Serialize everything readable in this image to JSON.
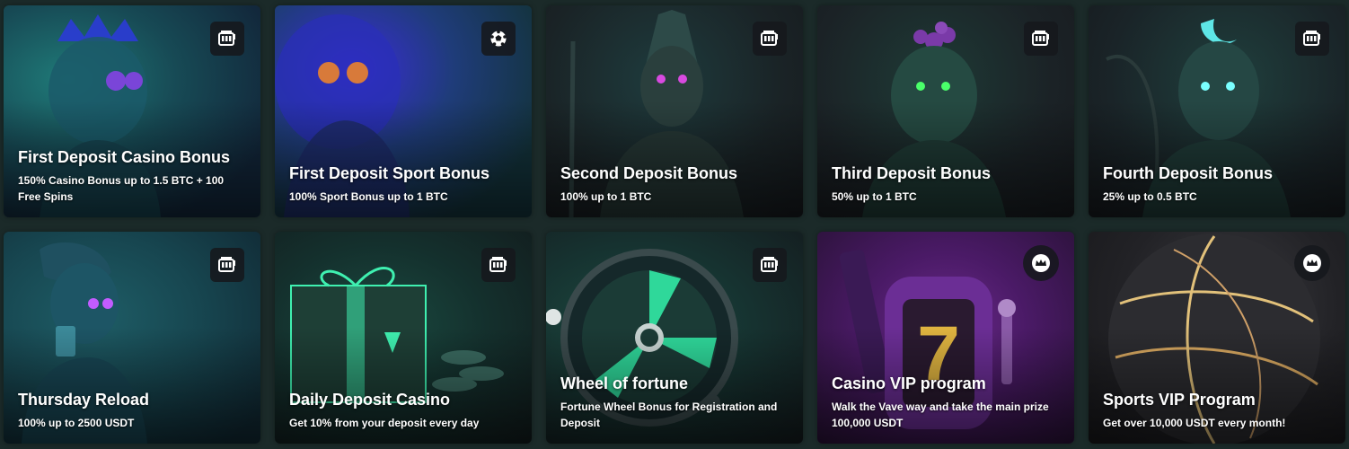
{
  "cards": [
    {
      "title": "First Deposit Casino Bonus",
      "desc": "150% Casino Bonus up to 1.5 BTC + 100 Free Spins",
      "badge_icon": "slot-machine-icon"
    },
    {
      "title": "First Deposit Sport Bonus",
      "desc": "100% Sport Bonus up to 1 BTC",
      "badge_icon": "soccer-ball-icon"
    },
    {
      "title": "Second Deposit Bonus",
      "desc": "100% up to 1 BTC",
      "badge_icon": "slot-machine-icon"
    },
    {
      "title": "Third Deposit Bonus",
      "desc": "50% up to 1 BTC",
      "badge_icon": "slot-machine-icon"
    },
    {
      "title": "Fourth Deposit Bonus",
      "desc": "25% up to 0.5 BTC",
      "badge_icon": "slot-machine-icon"
    },
    {
      "title": "Thursday Reload",
      "desc": "100% up to 2500 USDT",
      "badge_icon": "slot-machine-icon"
    },
    {
      "title": "Daily Deposit Casino",
      "desc": "Get 10% from your deposit every day",
      "badge_icon": "slot-machine-icon"
    },
    {
      "title": "Wheel of fortune",
      "desc": "Fortune Wheel Bonus for Registration and Deposit",
      "badge_icon": "slot-machine-icon"
    },
    {
      "title": "Casino VIP program",
      "desc": "Walk the Vave way and take the main prize 100,000 USDT",
      "badge_icon": "crown-icon"
    },
    {
      "title": "Sports VIP Program",
      "desc": "Get over 10,000 USDT every month!",
      "badge_icon": "crown-icon"
    }
  ],
  "colors": {
    "page_bg": "#1b2a29",
    "badge_bg": "#16181c",
    "text": "#ffffff"
  }
}
